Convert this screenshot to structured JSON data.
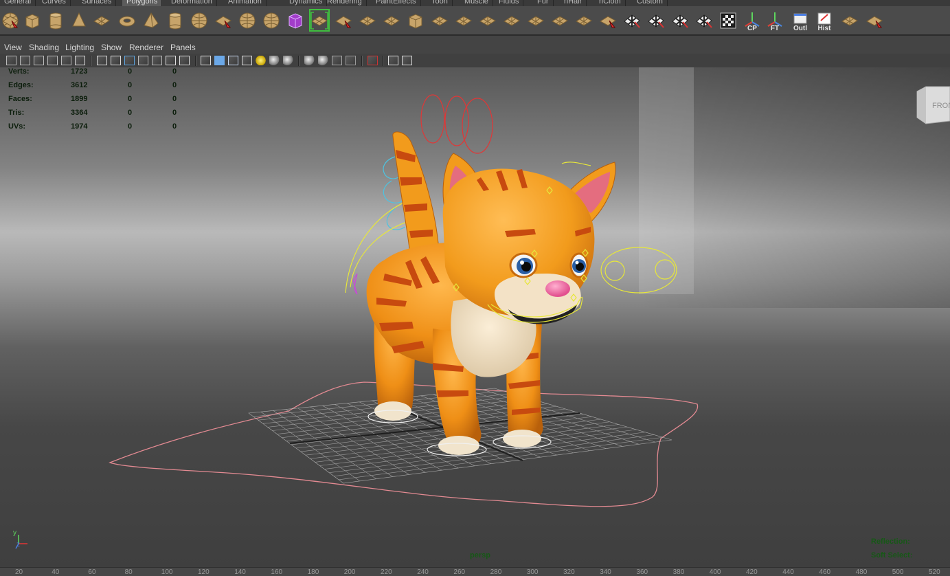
{
  "shelf_tabs": [
    {
      "label": "General",
      "active": false
    },
    {
      "label": "Curves",
      "active": false
    },
    {
      "label": "Surfaces",
      "active": false
    },
    {
      "label": "Polygons",
      "active": true
    },
    {
      "label": "Deformation",
      "active": false
    },
    {
      "label": "Animation",
      "active": false
    },
    {
      "label": "Dynamics",
      "active": false
    },
    {
      "label": "Rendering",
      "active": false
    },
    {
      "label": "PaintEffects",
      "active": false
    },
    {
      "label": "Toon",
      "active": false
    },
    {
      "label": "Muscle",
      "active": false
    },
    {
      "label": "Fluids",
      "active": false
    },
    {
      "label": "Fur",
      "active": false
    },
    {
      "label": "nHair",
      "active": false
    },
    {
      "label": "nCloth",
      "active": false
    },
    {
      "label": "Custom",
      "active": false
    }
  ],
  "shelf_icons": [
    {
      "name": "poly-sphere-icon",
      "kind": "sphere"
    },
    {
      "name": "poly-cube-icon",
      "kind": "cube"
    },
    {
      "name": "poly-cylinder-icon",
      "kind": "cylinder"
    },
    {
      "name": "poly-cone-icon",
      "kind": "cone"
    },
    {
      "name": "poly-plane-icon",
      "kind": "plane"
    },
    {
      "name": "poly-torus-icon",
      "kind": "torus"
    },
    {
      "name": "poly-pyramid-icon",
      "kind": "pyramid"
    },
    {
      "name": "poly-pipe-icon",
      "kind": "cylinder"
    },
    {
      "name": "poly-soccerball-icon",
      "kind": "sphere"
    },
    {
      "name": "combine-icon",
      "kind": "tool"
    },
    {
      "name": "separate-icon",
      "kind": "sphere"
    },
    {
      "name": "extract-icon",
      "kind": "sphere"
    },
    {
      "name": "smooth-proxy-icon",
      "kind": "cube-purple"
    },
    {
      "name": "smooth-icon",
      "kind": "plane-sel",
      "selected": true
    },
    {
      "name": "append-polygon-icon",
      "kind": "tool"
    },
    {
      "name": "split-polygon-icon",
      "kind": "plane"
    },
    {
      "name": "insert-edge-loop-icon",
      "kind": "plane"
    },
    {
      "name": "offset-edge-loop-icon",
      "kind": "cube"
    },
    {
      "name": "extrude-icon",
      "kind": "plane"
    },
    {
      "name": "bridge-icon",
      "kind": "plane"
    },
    {
      "name": "bevel-icon",
      "kind": "plane"
    },
    {
      "name": "merge-icon",
      "kind": "plane"
    },
    {
      "name": "collapse-icon",
      "kind": "plane"
    },
    {
      "name": "sculpt-geometry-icon",
      "kind": "plane"
    },
    {
      "name": "planar-mapping-icon",
      "kind": "plane"
    },
    {
      "name": "normal-icon",
      "kind": "tool"
    },
    {
      "name": "uv-checker-icon",
      "kind": "checker"
    },
    {
      "name": "uv-layout-icon",
      "kind": "checker"
    },
    {
      "name": "cut-uv-icon",
      "kind": "checker"
    },
    {
      "name": "sew-uv-icon",
      "kind": "checker"
    },
    {
      "name": "uv-editor-icon",
      "kind": "checker-frame"
    },
    {
      "name": "center-pivot-icon",
      "kind": "axis",
      "label": "CP"
    },
    {
      "name": "freeze-transform-icon",
      "kind": "axis",
      "label": "FT"
    },
    {
      "name": "outliner-icon",
      "kind": "window",
      "label": "Outl"
    },
    {
      "name": "history-icon",
      "kind": "note",
      "label": "Hist"
    },
    {
      "name": "transfer-attributes-icon",
      "kind": "plane"
    },
    {
      "name": "reduce-icon",
      "kind": "tool"
    },
    {
      "name": "cleanup-icon",
      "kind": "tool"
    }
  ],
  "panel_menu": [
    "View",
    "Shading",
    "Lighting",
    "Show",
    "Renderer",
    "Panels"
  ],
  "panel_icons": [
    "select-camera-icon",
    "camera-attributes-icon",
    "bookmarks-icon",
    "image-plane-icon",
    "two-d-pan-zoom-icon",
    "grease-pencil-icon",
    "grid-icon",
    "film-gate-icon",
    "resolution-gate-icon",
    "gate-mask-icon",
    "field-chart-icon",
    "safe-title-icon",
    "wireframe-icon",
    "smooth-shade-icon",
    "wireframe-on-shaded-icon",
    "textured-icon",
    "use-all-lights-icon",
    "shadows-icon",
    "screen-space-ao-icon",
    "motion-blur-icon",
    "multisample-aa-icon",
    "depth-of-field-icon",
    "isolate-select-icon",
    "xray-icon",
    "xray-joints-icon",
    "backface-culling-icon",
    "viewport-2-icon"
  ],
  "stats": [
    {
      "label": "Verts:",
      "total": "1723",
      "selected": "0",
      "component": "0"
    },
    {
      "label": "Edges:",
      "total": "3612",
      "selected": "0",
      "component": "0"
    },
    {
      "label": "Faces:",
      "total": "1899",
      "selected": "0",
      "component": "0"
    },
    {
      "label": "Tris:",
      "total": "3364",
      "selected": "0",
      "component": "0"
    },
    {
      "label": "UVs:",
      "total": "1974",
      "selected": "0",
      "component": "0"
    }
  ],
  "viewport": {
    "camera_name": "persp",
    "viewcube_face": "FRONT",
    "axis_y": "y",
    "axis_z": "z",
    "reflection_label": "Reflection:",
    "soft_select_label": "Soft Select:"
  },
  "ruler_ticks": [
    "20",
    "40",
    "60",
    "80",
    "100",
    "120",
    "140",
    "160",
    "180",
    "200",
    "220",
    "240",
    "260",
    "280",
    "300",
    "320",
    "340",
    "360",
    "380",
    "400",
    "420",
    "440",
    "460",
    "480",
    "500",
    "520"
  ],
  "colors": {
    "hud_text": "#0c1e0c",
    "shelf_selected": "#3fbf3f",
    "cat_orange": "#f29b1c",
    "cat_stripe": "#c74a0f",
    "control_yellow": "#e7e73a",
    "control_red": "#e23636"
  }
}
